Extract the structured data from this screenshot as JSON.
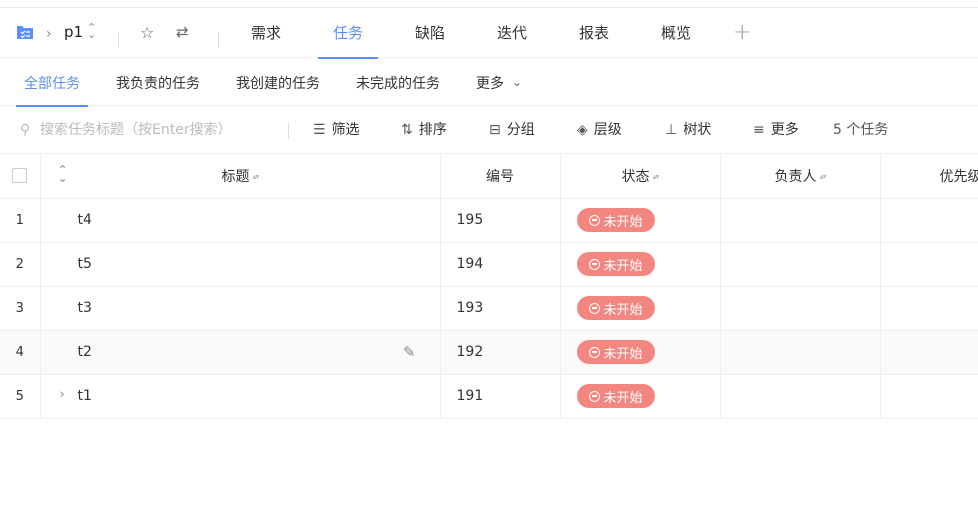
{
  "header": {
    "project_name": "p1",
    "tabs": [
      {
        "label": "需求"
      },
      {
        "label": "任务"
      },
      {
        "label": "缺陷"
      },
      {
        "label": "迭代"
      },
      {
        "label": "报表"
      },
      {
        "label": "概览"
      }
    ],
    "add_tab": "+"
  },
  "subnav": {
    "tabs": [
      {
        "label": "全部任务"
      },
      {
        "label": "我负责的任务"
      },
      {
        "label": "我创建的任务"
      },
      {
        "label": "未完成的任务"
      },
      {
        "label": "更多"
      }
    ]
  },
  "toolbar": {
    "search_placeholder": "搜索任务标题（按Enter搜索）",
    "filter": "筛选",
    "sort": "排序",
    "group": "分组",
    "level": "层级",
    "tree": "树状",
    "more": "更多",
    "count": "5 个任务"
  },
  "table": {
    "columns": {
      "title": "标题",
      "code": "编号",
      "status": "状态",
      "assignee": "负责人",
      "priority": "优先级"
    },
    "rows": [
      {
        "index": "1",
        "title": "t4",
        "code": "195",
        "status": "未开始"
      },
      {
        "index": "2",
        "title": "t5",
        "code": "194",
        "status": "未开始"
      },
      {
        "index": "3",
        "title": "t3",
        "code": "193",
        "status": "未开始"
      },
      {
        "index": "4",
        "title": "t2",
        "code": "192",
        "status": "未开始"
      },
      {
        "index": "5",
        "title": "t1",
        "code": "191",
        "status": "未开始"
      }
    ]
  },
  "colors": {
    "accent": "#5b8ff9",
    "status_not_started": "#f48682"
  }
}
